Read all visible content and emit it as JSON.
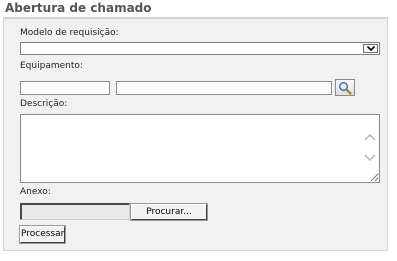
{
  "form": {
    "title": "Abertura de chamado",
    "model_label": "Modelo de requisição:",
    "model_selected": "",
    "equipment_label": "Equipamento:",
    "equipment_code": "",
    "equipment_name": "",
    "description_label": "Descrição:",
    "description_value": "",
    "attachment_label": "Anexo:",
    "browse_label": "Procurar...",
    "submit_label": "Processar"
  },
  "icons": {
    "lookup": "magnifier-icon",
    "dropdown": "chevron-down-icon",
    "scroll_up": "chevron-up-icon",
    "scroll_down": "chevron-down-icon"
  }
}
